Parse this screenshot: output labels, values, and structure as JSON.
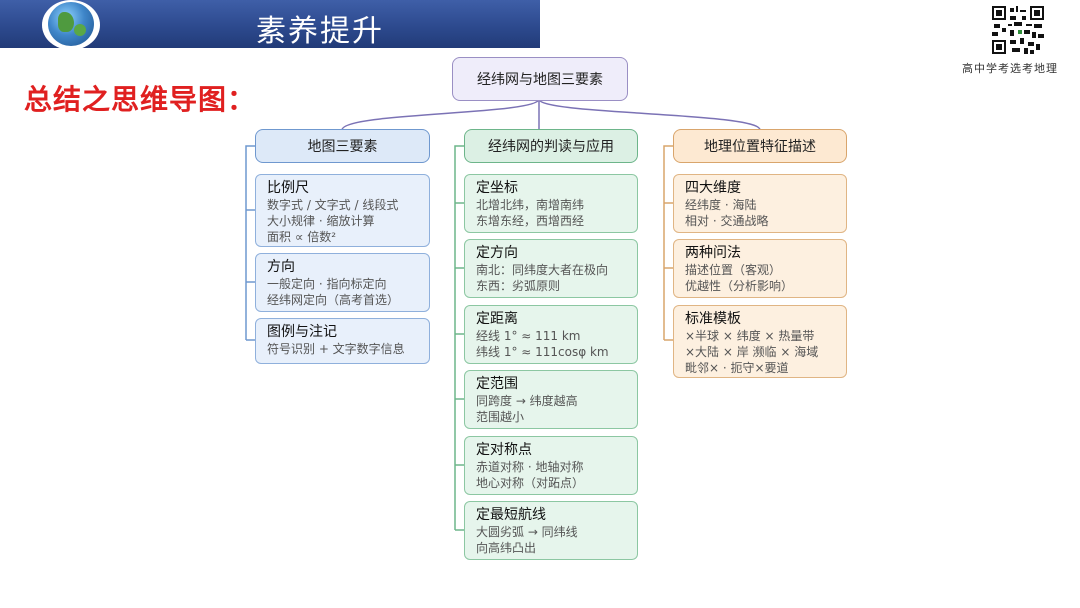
{
  "header": {
    "title": "素养提升"
  },
  "brand": {
    "caption": "高中学考选考地理"
  },
  "summary": {
    "title": "总结之思维导图："
  },
  "colors": {
    "banner": "#2d4a8e",
    "summary": "#e02020",
    "blue": "#6f98cf",
    "green": "#6db58a",
    "orange": "#d9a56c"
  },
  "mindmap": {
    "root": "经纬网与地图三要素",
    "branches": [
      {
        "title": "地图三要素",
        "items": [
          {
            "title": "比例尺",
            "lines": [
              "数字式 / 文字式 / 线段式",
              "大小规律 · 缩放计算",
              "面积 ∝ 倍数²"
            ]
          },
          {
            "title": "方向",
            "lines": [
              "一般定向 · 指向标定向",
              "经纬网定向（高考首选）"
            ]
          },
          {
            "title": "图例与注记",
            "lines": [
              "符号识别 + 文字数字信息"
            ]
          }
        ]
      },
      {
        "title": "经纬网的判读与应用",
        "items": [
          {
            "title": "定坐标",
            "lines": [
              "北增北纬，南增南纬",
              "东增东经，西增西经"
            ]
          },
          {
            "title": "定方向",
            "lines": [
              "南北：同纬度大者在极向",
              "东西：劣弧原则"
            ]
          },
          {
            "title": "定距离",
            "lines": [
              "经线 1° ≈ 111 km",
              "纬线 1° ≈ 111cosφ km"
            ]
          },
          {
            "title": "定范围",
            "lines": [
              "同跨度 → 纬度越高",
              "范围越小"
            ]
          },
          {
            "title": "定对称点",
            "lines": [
              "赤道对称 · 地轴对称",
              "地心对称（对跖点）"
            ]
          },
          {
            "title": "定最短航线",
            "lines": [
              "大圆劣弧 → 同纬线",
              "向高纬凸出"
            ]
          }
        ]
      },
      {
        "title": "地理位置特征描述",
        "items": [
          {
            "title": "四大维度",
            "lines": [
              "经纬度 · 海陆",
              "相对 · 交通战略"
            ]
          },
          {
            "title": "两种问法",
            "lines": [
              "描述位置（客观）",
              "优越性（分析影响）"
            ]
          },
          {
            "title": "标准模板",
            "lines": [
              "×半球 × 纬度 × 热量带",
              "×大陆 × 岸 濒临 × 海域",
              "毗邻× · 扼守×要道"
            ]
          }
        ]
      }
    ]
  }
}
